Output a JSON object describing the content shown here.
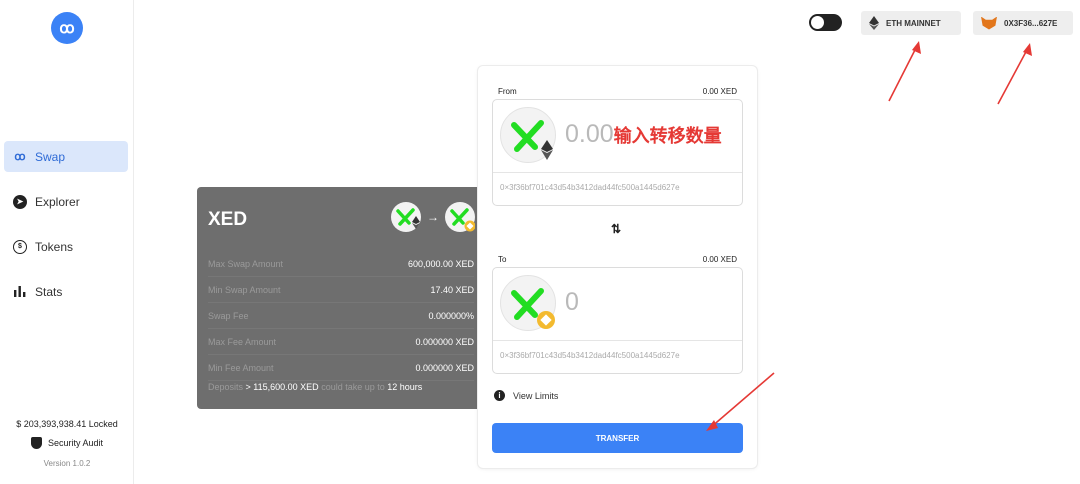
{
  "sidebar": {
    "logo_glyph": "ꝏ",
    "items": [
      {
        "label": "Swap",
        "icon": "swap-icon",
        "active": true
      },
      {
        "label": "Explorer",
        "icon": "compass-icon",
        "active": false
      },
      {
        "label": "Tokens",
        "icon": "tokens-icon",
        "active": false
      },
      {
        "label": "Stats",
        "icon": "stats-icon",
        "active": false
      }
    ],
    "locked": "$ 203,393,938.41 Locked",
    "audit": "Security Audit",
    "version": "Version 1.0.2"
  },
  "topbar": {
    "network": "ETH MAINNET",
    "wallet": "0X3F36...627E"
  },
  "info": {
    "token": "XED",
    "arrow": "→",
    "rows": [
      {
        "label": "Max Swap Amount",
        "value": "600,000.00 XED"
      },
      {
        "label": "Min Swap Amount",
        "value": "17.40 XED"
      },
      {
        "label": "Swap Fee",
        "value": "0.000000%"
      },
      {
        "label": "Max Fee Amount",
        "value": "0.000000 XED"
      },
      {
        "label": "Min Fee Amount",
        "value": "0.000000 XED"
      }
    ],
    "deposit_prefix": "Deposits",
    "deposit_amount": "> 115,600.00 XED",
    "deposit_mid": "could take up to",
    "deposit_time": "12 hours"
  },
  "swap": {
    "from_label": "From",
    "from_balance": "0.00 XED",
    "from_amount": "0.00",
    "from_hint": "输入转移数量",
    "from_address": "0×3f36bf701c43d54b3412dad44fc500a1445d627e",
    "swap_arrows": "⇅",
    "to_label": "To",
    "to_balance": "0.00 XED",
    "to_amount": "0",
    "to_address": "0×3f36bf701c43d54b3412dad44fc500a1445d627e",
    "view_limits": "View Limits",
    "transfer": "TRANSFER"
  },
  "colors": {
    "accent": "#3b82f6",
    "annotation": "#e53935",
    "token_green": "#22dd22"
  }
}
